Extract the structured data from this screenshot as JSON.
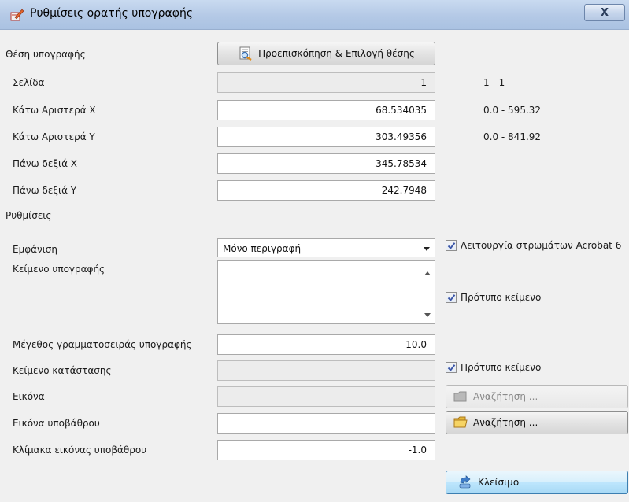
{
  "window": {
    "title": "Ρυθμίσεις ορατής υπογραφής",
    "close_label": "X"
  },
  "position": {
    "section_label": "Θέση υπογραφής",
    "preview_button_label": "Προεπισκόπηση & Επιλογή θέσης",
    "page": {
      "label": "Σελίδα",
      "value": "1",
      "range": "1 - 1"
    },
    "lower_left_x": {
      "label": "Κάτω Αριστερά Χ",
      "value": "68.534035",
      "range": "0.0 - 595.32"
    },
    "lower_left_y": {
      "label": "Κάτω Αριστερά Υ",
      "value": "303.49356",
      "range": "0.0 - 841.92"
    },
    "upper_right_x": {
      "label": "Πάνω δεξιά Χ",
      "value": "345.78534"
    },
    "upper_right_y": {
      "label": "Πάνω δεξιά Υ",
      "value": "242.7948"
    }
  },
  "settings": {
    "section_label": "Ρυθμίσεις",
    "appearance": {
      "label": "Εμφάνιση",
      "selected": "Μόνο περιγραφή"
    },
    "acrobat_layers": {
      "label": "Λειτουργία στρωμάτων Acrobat 6",
      "checked": true
    },
    "signature_text": {
      "label": "Κείμενο υπογραφής",
      "value": ""
    },
    "default_text_1": {
      "label": "Πρότυπο κείμενο",
      "checked": true
    },
    "font_size": {
      "label": "Μέγεθος γραμματοσειράς υπογραφής",
      "value": "10.0"
    },
    "status_text": {
      "label": "Κείμενο κατάστασης",
      "value": ""
    },
    "default_text_2": {
      "label": "Πρότυπο κείμενο",
      "checked": true
    },
    "image": {
      "label": "Εικόνα",
      "value": "",
      "browse_label": "Αναζήτηση ..."
    },
    "background_image": {
      "label": "Εικόνα υποβάθρου",
      "value": "",
      "browse_label": "Αναζήτηση ..."
    },
    "background_scale": {
      "label": "Κλίμακα εικόνας υποβάθρου",
      "value": "-1.0"
    }
  },
  "footer": {
    "close_label": "Κλείσιμο"
  },
  "icons": [
    "app-signature-icon",
    "window-close-icon",
    "preview-magnifier-icon",
    "folder-icon",
    "open-folder-icon",
    "close-arrow-icon",
    "checkmark-icon",
    "dropdown-arrow-icon"
  ]
}
